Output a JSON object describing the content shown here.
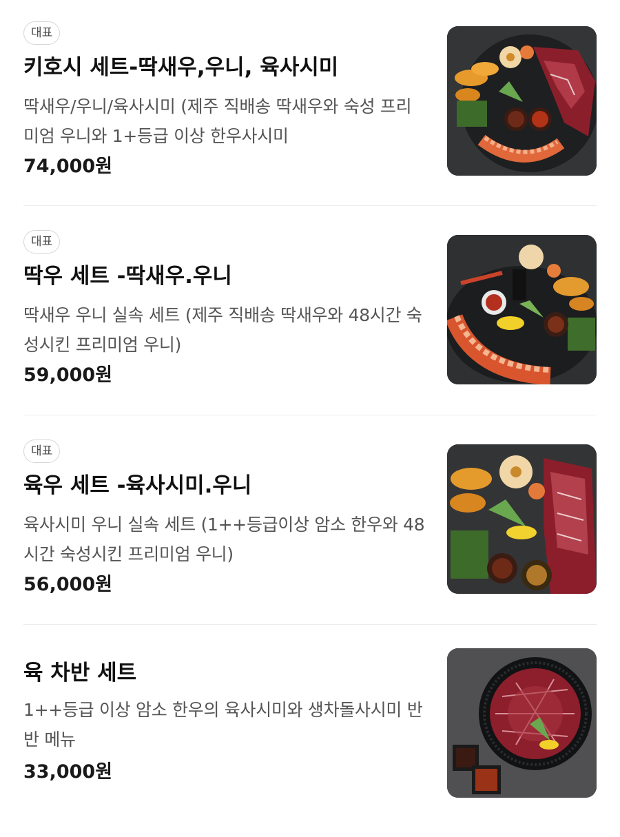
{
  "menu": {
    "items": [
      {
        "badge": "대표",
        "name": "키호시 세트-딱새우,우니, 육사시미",
        "description": "딱새우/우니/육사시미 (제주 직배송 딱새우와 숙성 프리미엄 우니와 1+등급 이상 한우사시미",
        "price": "74,000원"
      },
      {
        "badge": "대표",
        "name": "딱우 세트 -딱새우.우니",
        "description": "딱새우 우니 실속 세트 (제주 직배송 딱새우와 48시간 숙성시킨 프리미엄 우니)",
        "price": "59,000원"
      },
      {
        "badge": "대표",
        "name": "육우 세트 -육사시미.우니",
        "description": "육사시미 우니 실속 세트 (1++등급이상 암소 한우와 48시간 숙성시킨 프리미엄 우니)",
        "price": "56,000원"
      },
      {
        "name": "육 차반 세트",
        "description": "1++등급 이상 암소 한우의 육사시미와 생차돌사시미 반반 메뉴",
        "price": "33,000원"
      }
    ]
  }
}
